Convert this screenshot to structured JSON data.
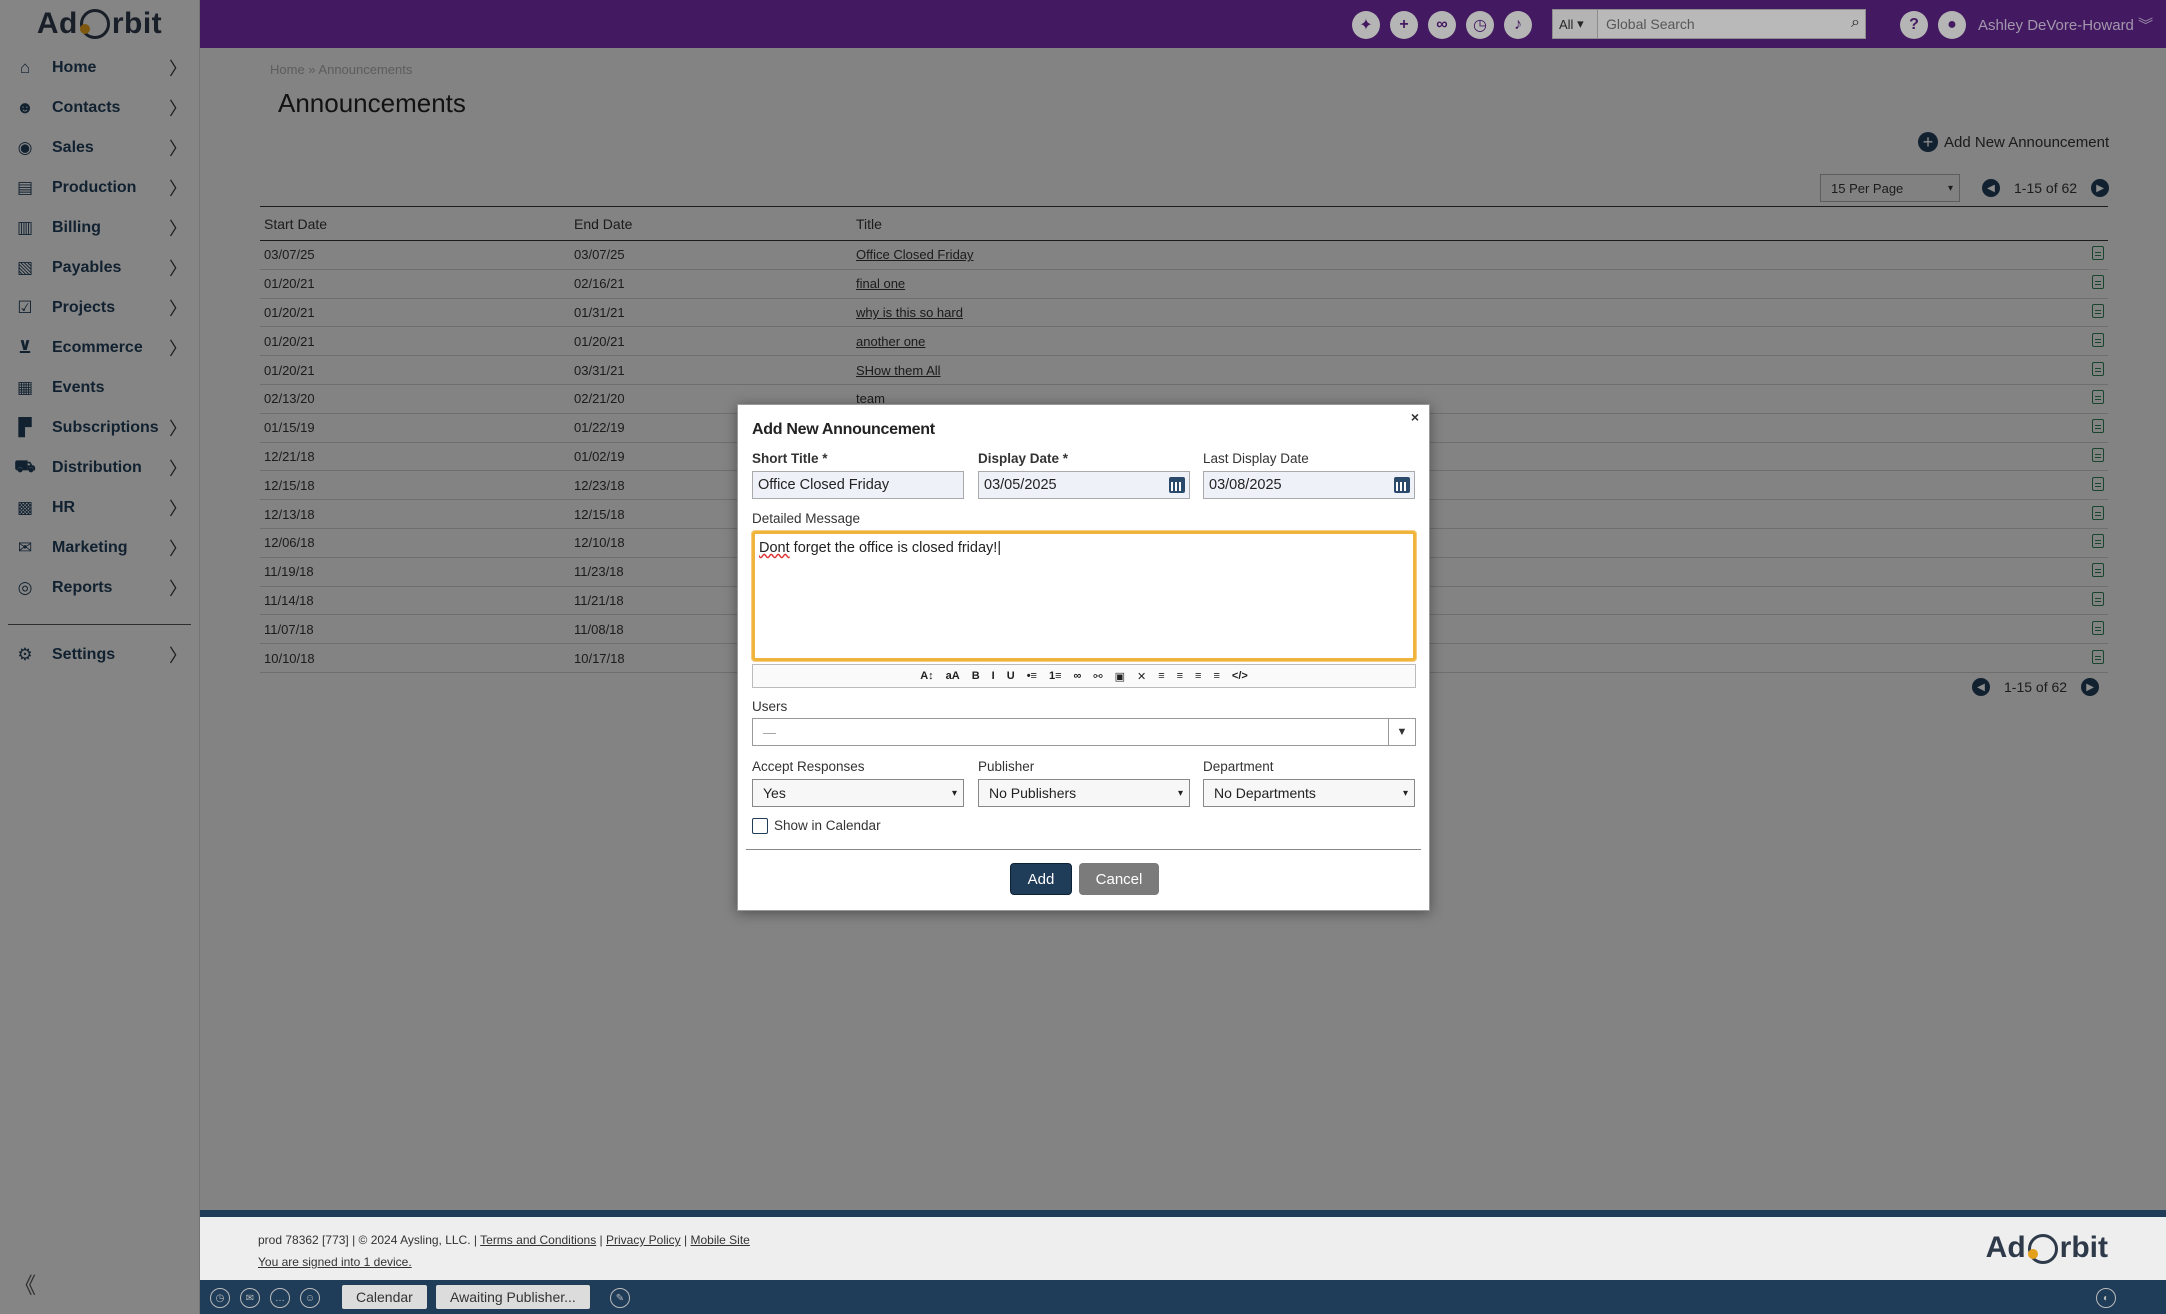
{
  "app": {
    "logo_left": "Ad",
    "logo_right": "rbit"
  },
  "sidebar": {
    "items": [
      {
        "label": "Home",
        "icon": "home-icon"
      },
      {
        "label": "Contacts",
        "icon": "contacts-icon"
      },
      {
        "label": "Sales",
        "icon": "sales-icon"
      },
      {
        "label": "Production",
        "icon": "production-icon"
      },
      {
        "label": "Billing",
        "icon": "billing-icon"
      },
      {
        "label": "Payables",
        "icon": "payables-icon"
      },
      {
        "label": "Projects",
        "icon": "projects-icon"
      },
      {
        "label": "Ecommerce",
        "icon": "cart-icon"
      },
      {
        "label": "Events",
        "icon": "calendar-icon"
      },
      {
        "label": "Subscriptions",
        "icon": "subscriptions-icon"
      },
      {
        "label": "Distribution",
        "icon": "truck-icon"
      },
      {
        "label": "HR",
        "icon": "hr-icon"
      },
      {
        "label": "Marketing",
        "icon": "mail-icon"
      },
      {
        "label": "Reports",
        "icon": "reports-icon"
      }
    ],
    "settings_label": "Settings",
    "chevron": "〉",
    "collapse_glyph": "《"
  },
  "topbar": {
    "search_scope": "All",
    "search_placeholder": "Global Search",
    "help": "?",
    "user_name": "Ashley DeVore-Howard"
  },
  "page": {
    "breadcrumb": "Home » Announcements",
    "title": "Announcements",
    "add_new_label": "Add New Announcement",
    "per_page": "15 Per Page",
    "range_text": "1-15 of 62"
  },
  "table": {
    "headers": [
      "Start Date",
      "End Date",
      "Title"
    ],
    "rows": [
      {
        "start": "03/07/25",
        "end": "03/07/25",
        "title": "Office Closed Friday"
      },
      {
        "start": "01/20/21",
        "end": "02/16/21",
        "title": "final one"
      },
      {
        "start": "01/20/21",
        "end": "01/31/21",
        "title": "why is this so hard"
      },
      {
        "start": "01/20/21",
        "end": "01/20/21",
        "title": "another one"
      },
      {
        "start": "01/20/21",
        "end": "03/31/21",
        "title": "SHow them All"
      },
      {
        "start": "02/13/20",
        "end": "02/21/20",
        "title": "team"
      },
      {
        "start": "01/15/19",
        "end": "01/22/19",
        "title": ""
      },
      {
        "start": "12/21/18",
        "end": "01/02/19",
        "title": ""
      },
      {
        "start": "12/15/18",
        "end": "12/23/18",
        "title": ""
      },
      {
        "start": "12/13/18",
        "end": "12/15/18",
        "title": ""
      },
      {
        "start": "12/06/18",
        "end": "12/10/18",
        "title": ""
      },
      {
        "start": "11/19/18",
        "end": "11/23/18",
        "title": ""
      },
      {
        "start": "11/14/18",
        "end": "11/21/18",
        "title": ""
      },
      {
        "start": "11/07/18",
        "end": "11/08/18",
        "title": ""
      },
      {
        "start": "10/10/18",
        "end": "10/17/18",
        "title": ""
      }
    ]
  },
  "modal": {
    "title": "Add New Announcement",
    "close": "×",
    "short_title_label": "Short Title *",
    "short_title_value": "Office Closed Friday",
    "display_date_label": "Display Date *",
    "display_date_value": "03/05/2025",
    "last_display_date_label": "Last Display Date",
    "last_display_date_value": "03/08/2025",
    "detailed_message_label": "Detailed Message",
    "message_word1": "Dont",
    "message_rest": " forget the office is closed friday!",
    "users_label": "Users",
    "users_value": "—",
    "accept_responses_label": "Accept Responses",
    "accept_responses_value": "Yes",
    "publisher_label": "Publisher",
    "publisher_value": "No Publishers",
    "department_label": "Department",
    "department_value": "No Departments",
    "show_in_calendar_label": "Show in Calendar",
    "add_button": "Add",
    "cancel_button": "Cancel",
    "toolbar": [
      "A↕",
      "aA",
      "B",
      "I",
      "U",
      "•≡",
      "1≡",
      "∞",
      "⚯",
      "▣",
      "✕",
      "≡",
      "≡",
      "≡",
      "≡",
      "</>"
    ]
  },
  "footer": {
    "prefix": "prod 78362 [773] | © 2024 Aysling, LLC. |",
    "terms": "Terms and Conditions",
    "privacy": "Privacy Policy",
    "mobile": "Mobile Site",
    "signed_in": "You are signed into 1 device."
  },
  "taskbar": {
    "calendar": "Calendar",
    "awaiting": "Awaiting Publisher..."
  }
}
